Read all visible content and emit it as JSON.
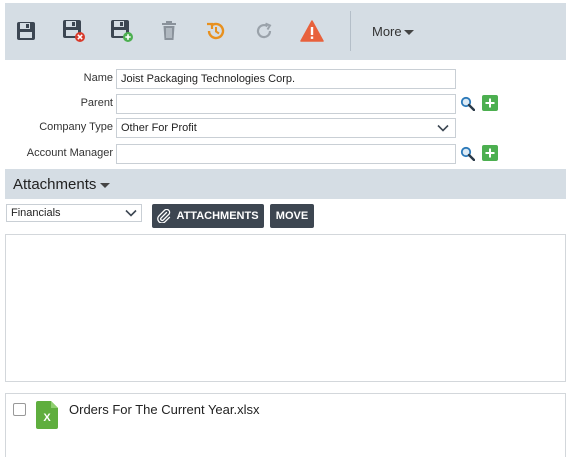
{
  "toolbar": {
    "buttons": [
      {
        "name": "save",
        "icon": "floppy-icon"
      },
      {
        "name": "save-and-close",
        "icon": "floppy-close-icon"
      },
      {
        "name": "save-and-new",
        "icon": "floppy-add-icon"
      },
      {
        "name": "delete",
        "icon": "trash-icon"
      },
      {
        "name": "history",
        "icon": "history-icon"
      },
      {
        "name": "refresh",
        "icon": "refresh-icon"
      },
      {
        "name": "warning",
        "icon": "warning-icon"
      }
    ],
    "more_label": "More"
  },
  "form": {
    "name_label": "Name",
    "name_value": "Joist Packaging Technologies Corp.",
    "parent_label": "Parent",
    "parent_value": "",
    "company_type_label": "Company Type",
    "company_type_value": "Other For Profit",
    "account_manager_label": "Account Manager",
    "account_manager_value": ""
  },
  "attachments": {
    "header": "Attachments",
    "folder_value": "Financials",
    "attachments_button": "ATTACHMENTS",
    "move_button": "MOVE",
    "files": [
      {
        "name": "Orders For The Current Year.xlsx",
        "type": "excel"
      }
    ]
  },
  "colors": {
    "toolbar_bg": "#d5dde4",
    "dark_button": "#3d4651",
    "accent_orange": "#e8901e",
    "warning_red": "#e8613c",
    "plus_green": "#4caf50",
    "search_blue": "#2b79b9",
    "excel_green": "#5fae3e"
  }
}
